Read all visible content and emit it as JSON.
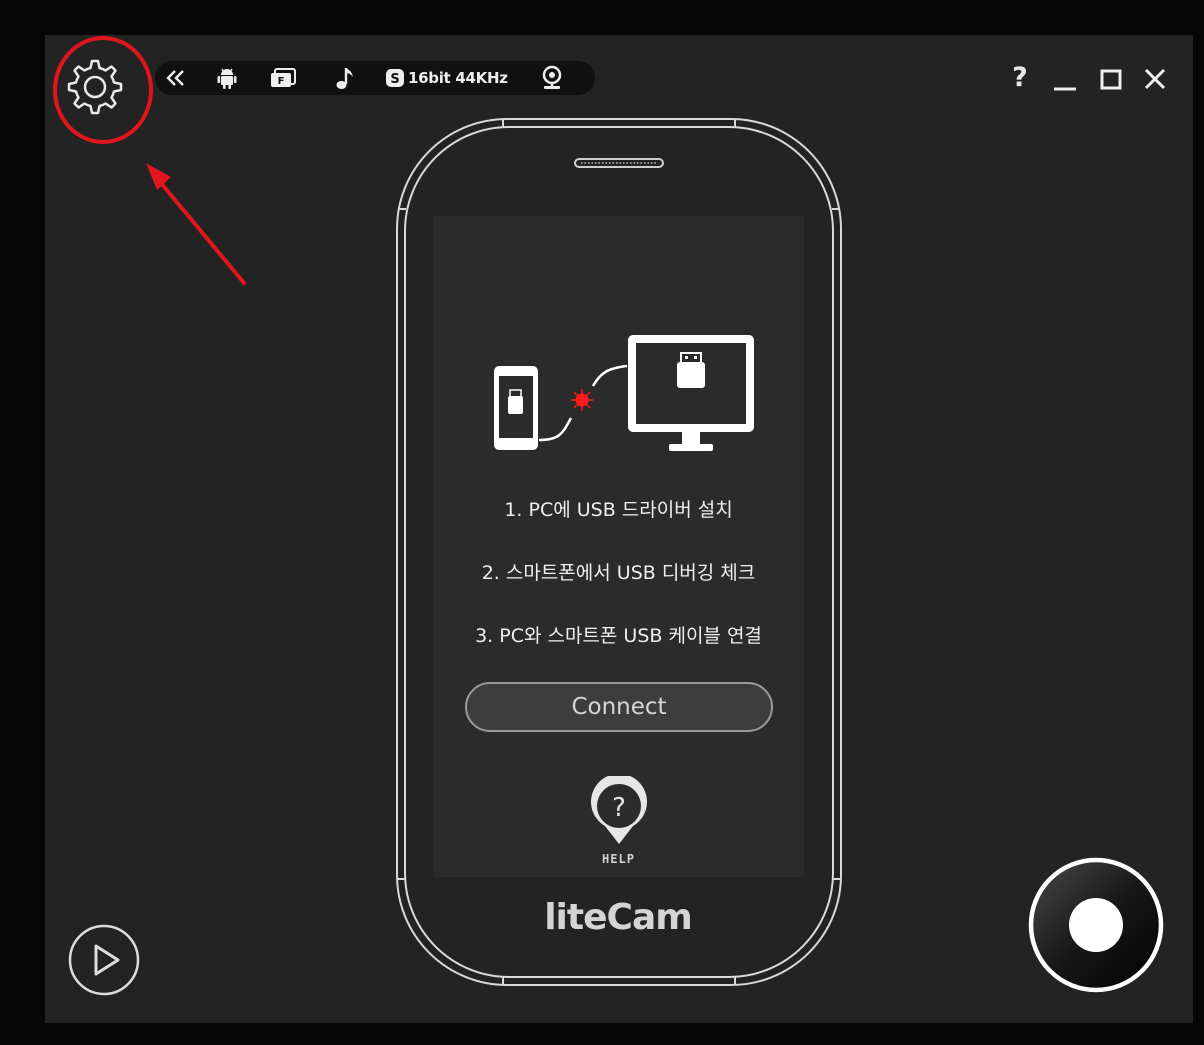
{
  "toolbar": {
    "audio_label": "16bit 44KHz",
    "audio_prefix_letter": "S",
    "screen_mode_letter": "F"
  },
  "steps": [
    "1. PC에 USB 드라이버 설치",
    "2. 스마트폰에서 USB 디버깅 체크",
    "3. PC와 스마트폰 USB 케이블 연결"
  ],
  "connect_label": "Connect",
  "help_label": "HELP",
  "brand": {
    "part1": "lite",
    "part2": "Cam"
  },
  "window_controls": {
    "help_glyph": "?"
  },
  "colors": {
    "annotation_red": "#e0161c",
    "background": "#232323",
    "usb_error_dot": "#ff1a1a"
  },
  "icons": [
    "gear-icon",
    "collapse-icon",
    "android-icon",
    "screen-mode-icon",
    "music-note-icon",
    "audio-s-icon",
    "webcam-icon",
    "help-icon",
    "minimize-icon",
    "maximize-icon",
    "close-icon",
    "play-icon",
    "record-icon",
    "usb-connection-illustration",
    "help-pin-icon"
  ]
}
